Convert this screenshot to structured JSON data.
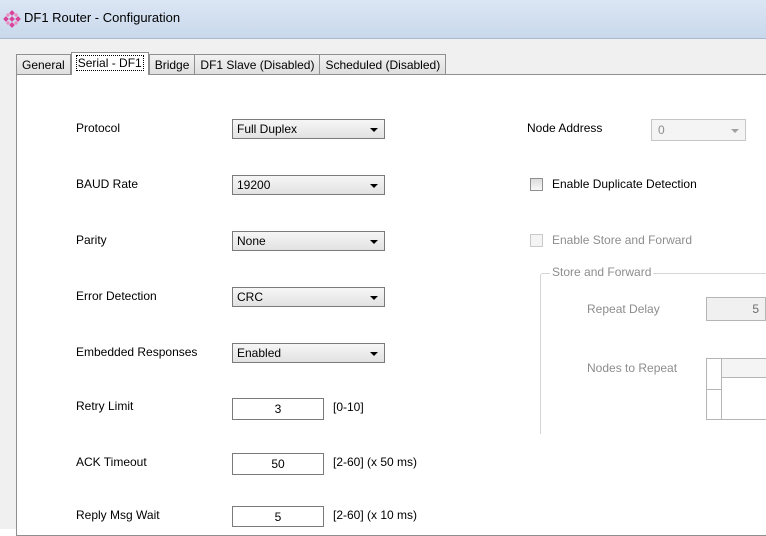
{
  "window": {
    "title": "DF1 Router - Configuration",
    "icon": "router-logo-icon"
  },
  "tabs": [
    {
      "label": "General",
      "active": false
    },
    {
      "label": "Serial - DF1",
      "active": true
    },
    {
      "label": "Bridge",
      "active": false
    },
    {
      "label": "DF1 Slave (Disabled)",
      "active": false
    },
    {
      "label": "Scheduled (Disabled)",
      "active": false
    }
  ],
  "serial": {
    "protocol": {
      "label": "Protocol",
      "value": "Full Duplex"
    },
    "baud_rate": {
      "label": "BAUD Rate",
      "value": "19200"
    },
    "parity": {
      "label": "Parity",
      "value": "None"
    },
    "error_detection": {
      "label": "Error Detection",
      "value": "CRC"
    },
    "embedded_responses": {
      "label": "Embedded Responses",
      "value": "Enabled"
    },
    "retry_limit": {
      "label": "Retry Limit",
      "value": "3",
      "range": "[0-10]"
    },
    "ack_timeout": {
      "label": "ACK Timeout",
      "value": "50",
      "range": "[2-60] (x 50 ms)"
    },
    "reply_msg_wait": {
      "label": "Reply Msg Wait",
      "value": "5",
      "range": "[2-60] (x 10 ms)"
    }
  },
  "right": {
    "node_address": {
      "label": "Node Address",
      "value": "0",
      "disabled": true
    },
    "enable_duplicate_detection": {
      "label": "Enable Duplicate Detection",
      "checked": false
    },
    "enable_store_and_forward": {
      "label": "Enable Store and Forward",
      "checked": false,
      "disabled": true
    },
    "store_and_forward": {
      "title": "Store and Forward",
      "repeat_delay": {
        "label": "Repeat Delay",
        "value": "5"
      },
      "nodes_to_repeat": {
        "label": "Nodes to Repeat"
      }
    }
  },
  "colors": {
    "titlebar": "#c9d8ec",
    "dialog_bg": "#f0f0f0",
    "panel_bg": "#ffffff",
    "disabled_text": "#8d8d8d",
    "icon_pink": "#d9439a"
  }
}
